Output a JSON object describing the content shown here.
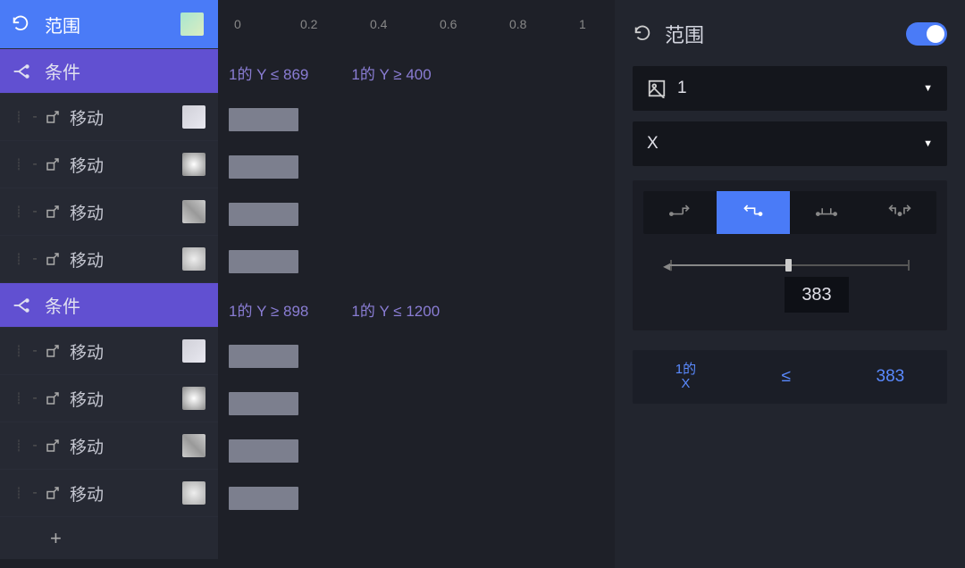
{
  "header": {
    "range_label": "范围"
  },
  "conditions": [
    {
      "label": "条件",
      "expr1": "1的 Y ≤ 869",
      "expr2": "1的 Y ≥ 400",
      "moves": [
        "移动",
        "移动",
        "移动",
        "移动"
      ]
    },
    {
      "label": "条件",
      "expr1": "1的 Y ≥ 898",
      "expr2": "1的 Y ≤ 1200",
      "moves": [
        "移动",
        "移动",
        "移动",
        "移动"
      ]
    }
  ],
  "add_label": "+",
  "ruler": {
    "ticks": [
      "0",
      "0.2",
      "0.4",
      "0.6",
      "0.8",
      "1"
    ]
  },
  "panel": {
    "title": "范围",
    "toggle": true,
    "select_primary": "1",
    "select_secondary": "X",
    "slider_value": "383",
    "readout_top": "1的",
    "readout_bottom": "X",
    "readout_op": "≤",
    "readout_value": "383"
  }
}
